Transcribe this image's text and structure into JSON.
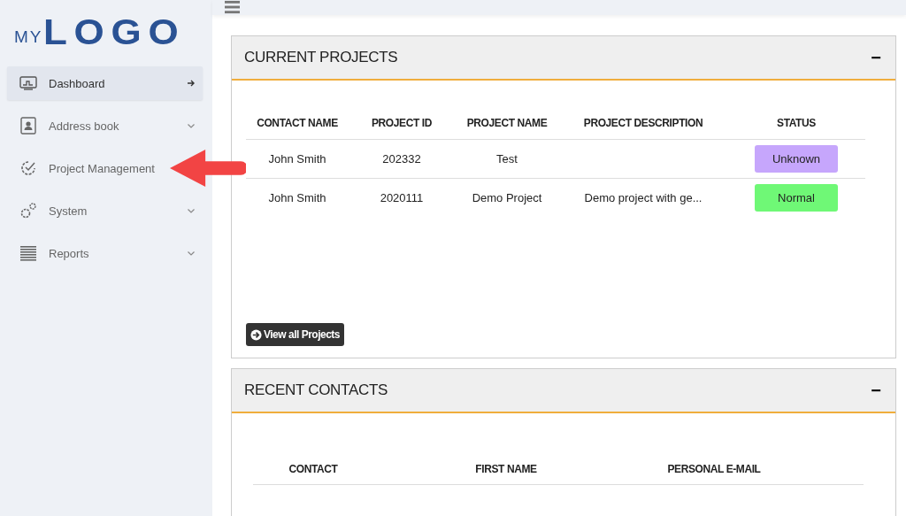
{
  "logo": {
    "small": "MY",
    "large": "LOGO"
  },
  "sidebar": {
    "items": [
      {
        "label": "Dashboard",
        "selected": true
      },
      {
        "label": "Address book",
        "selected": false,
        "expandable": true
      },
      {
        "label": "Project Management",
        "selected": false
      },
      {
        "label": "System",
        "selected": false,
        "expandable": true
      },
      {
        "label": "Reports",
        "selected": false,
        "expandable": true
      }
    ]
  },
  "annotation": {
    "kind": "arrow"
  },
  "current_projects": {
    "title": "CURRENT PROJECTS",
    "collapse": "−",
    "columns": [
      "CONTACT NAME",
      "PROJECT ID",
      "PROJECT NAME",
      "PROJECT DESCRIPTION",
      "STATUS"
    ],
    "rows": [
      {
        "cells": [
          "John Smith",
          "202332",
          "Test",
          ""
        ],
        "status": "Unknown",
        "color": "#c6a6fc"
      },
      {
        "cells": [
          "John Smith",
          "2020111",
          "Demo Project",
          "Demo project with ge..."
        ],
        "status": "Normal",
        "color": "#6ff876"
      }
    ],
    "button": "View all Projects"
  },
  "recent_contacts": {
    "title": "RECENT CONTACTS",
    "collapse": "−",
    "columns": [
      "CONTACT",
      "FIRST NAME",
      "PERSONAL E-MAIL"
    ]
  }
}
